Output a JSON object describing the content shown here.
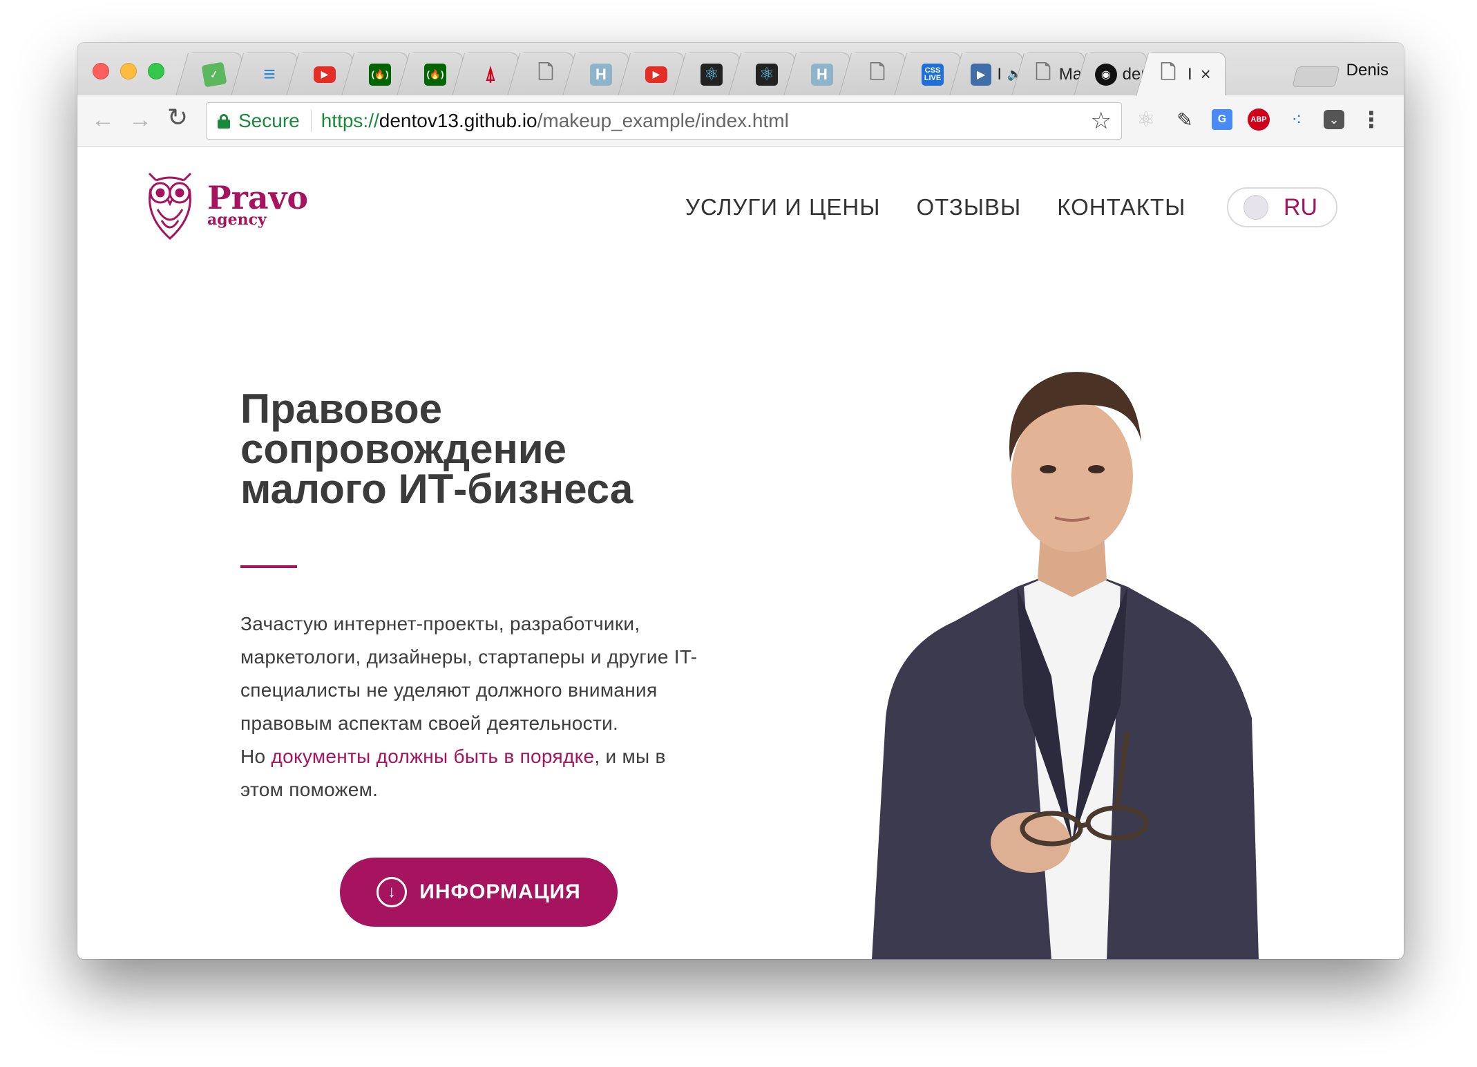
{
  "browser": {
    "user_name": "Denis",
    "tabs": [
      {
        "icon": "green-gear-icon",
        "color": "#5cb85c"
      },
      {
        "icon": "blue-filter-icon",
        "color": "#2f86d6"
      },
      {
        "icon": "youtube-icon",
        "color": "#e52d27"
      },
      {
        "icon": "freecodecamp-icon",
        "color": "#006400"
      },
      {
        "icon": "freecodecamp-icon",
        "color": "#006400"
      },
      {
        "icon": "radio-tower-icon",
        "color": "#d0021b"
      },
      {
        "icon": "page-icon",
        "color": "#777777"
      },
      {
        "icon": "h-letter-icon",
        "color": "#8fb3c8",
        "glyph": "H"
      },
      {
        "icon": "youtube-icon",
        "color": "#e52d27"
      },
      {
        "icon": "react-icon",
        "color": "#222222"
      },
      {
        "icon": "react-icon",
        "color": "#222222"
      },
      {
        "icon": "h-letter-icon",
        "color": "#8fb3c8",
        "glyph": "H"
      },
      {
        "icon": "page-icon",
        "color": "#777777"
      },
      {
        "icon": "css-live-icon",
        "color": "#1e6fd9",
        "glyph": "CSS LIVE"
      }
    ],
    "wide_tabs": [
      {
        "icon": "play-icon",
        "label": "I",
        "extra": "🔈"
      },
      {
        "icon": "page-icon",
        "label": "Mal"
      },
      {
        "icon": "github-icon",
        "label": "der"
      }
    ],
    "active_tab": {
      "icon": "page-icon",
      "label": "I",
      "close": "×"
    },
    "toolbar": {
      "back": "←",
      "forward": "→",
      "reload": "↻",
      "secure_label": "Secure",
      "url_scheme": "https://",
      "url_host": "dentov13.github.io",
      "url_path": "/makeup_example/index.html",
      "star": "☆",
      "menu": "⋮"
    }
  },
  "site": {
    "logo": {
      "name": "Pravo",
      "sub": "agency"
    },
    "nav": [
      "УСЛУГИ И ЦЕНЫ",
      "ОТЗЫВЫ",
      "КОНТАКТЫ"
    ],
    "lang": "RU",
    "hero": {
      "title_1": "Правовое",
      "title_2": "сопровождение",
      "title_3": "малого ИТ-бизнеса",
      "text_1": "Зачастую интернет-проекты, разработчики,",
      "text_2": "маркетологи, дизайнеры, стартаперы и другие IT-",
      "text_3": "специалисты не уделяют должного внимания",
      "text_4": "правовым аспектам своей деятельности.",
      "text_5_pre": "Но ",
      "text_5_accent": "документы должны быть в порядке",
      "text_5_post": ", и мы в",
      "text_6": "этом поможем.",
      "cta": "ИНФОРМАЦИЯ",
      "cta_icon": "↓"
    },
    "accent_color": "#a6135f"
  }
}
